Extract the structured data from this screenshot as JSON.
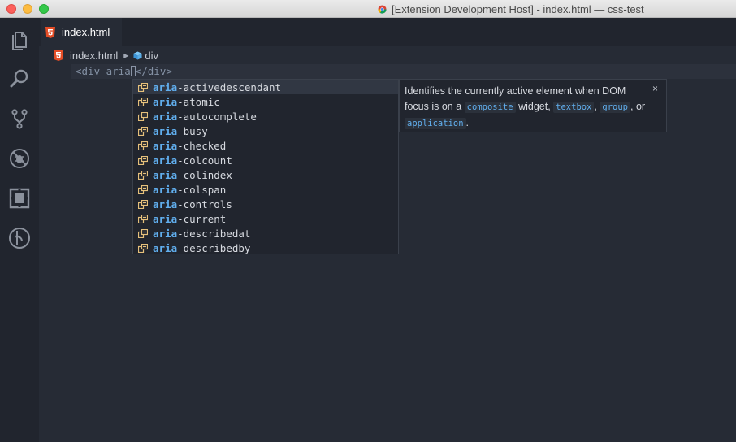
{
  "window": {
    "title": "[Extension Development Host] - index.html — css-test"
  },
  "activity_bar": {
    "items": [
      {
        "icon": "explorer-icon"
      },
      {
        "icon": "search-icon"
      },
      {
        "icon": "source-control-icon"
      },
      {
        "icon": "debug-icon"
      },
      {
        "icon": "extensions-icon"
      },
      {
        "icon": "git-lens-icon"
      }
    ]
  },
  "tabs": [
    {
      "label": "index.html",
      "icon": "html5-icon",
      "active": true
    }
  ],
  "breadcrumb": {
    "file": "index.html",
    "element": "div"
  },
  "editor": {
    "line_open": "<div aria",
    "line_close": "</div>"
  },
  "suggestions": {
    "match_prefix": "aria",
    "items": [
      {
        "suffix": "-activedescendant",
        "selected": true
      },
      {
        "suffix": "-atomic"
      },
      {
        "suffix": "-autocomplete"
      },
      {
        "suffix": "-busy"
      },
      {
        "suffix": "-checked"
      },
      {
        "suffix": "-colcount"
      },
      {
        "suffix": "-colindex"
      },
      {
        "suffix": "-colspan"
      },
      {
        "suffix": "-controls"
      },
      {
        "suffix": "-current"
      },
      {
        "suffix": "-describedat"
      },
      {
        "suffix": "-describedby"
      }
    ]
  },
  "details": {
    "text_1": "Identifies the currently active element when DOM focus is on a",
    "code_1": "composite",
    "text_2": "widget,",
    "code_2": "textbox",
    "text_3": ",",
    "code_3": "group",
    "text_4": ", or",
    "code_4": "application",
    "text_5": ".",
    "close": "×"
  },
  "colors": {
    "editor_bg": "#262b35",
    "sidebar_bg": "#21252e",
    "accent_blue": "#61afef",
    "html_orange": "#e44d26",
    "property_icon": "#e5c07b"
  }
}
